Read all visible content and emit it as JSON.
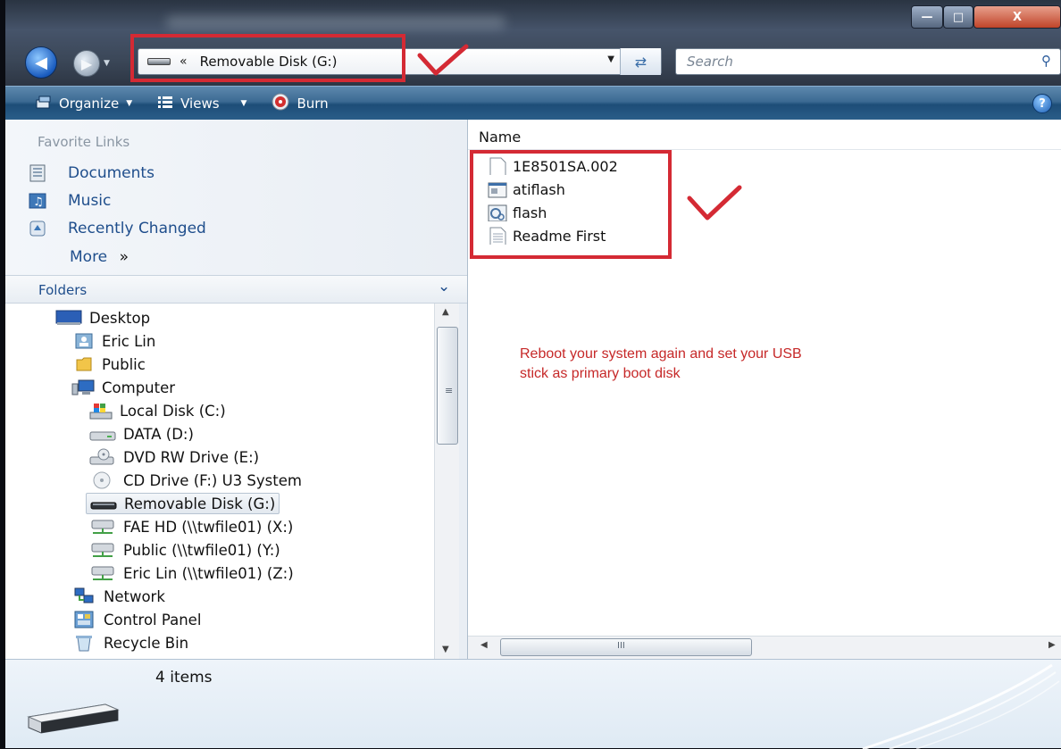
{
  "window": {
    "controls": {
      "minimize": "—",
      "maximize": "□",
      "close": "X"
    }
  },
  "address_bar": {
    "chevron": "«",
    "path": "Removable Disk (G:)"
  },
  "search": {
    "placeholder": "Search"
  },
  "toolbar": {
    "organize": "Organize",
    "views": "Views",
    "burn": "Burn",
    "help": "?"
  },
  "favorites": {
    "header": "Favorite Links",
    "items": [
      "Documents",
      "Music",
      "Recently Changed"
    ],
    "more": "More",
    "more_arrows": "»"
  },
  "folders": {
    "header": "Folders",
    "tree": [
      {
        "label": "Desktop",
        "icon": "desktop-icon"
      },
      {
        "label": "Eric Lin",
        "icon": "user-folder-icon"
      },
      {
        "label": "Public",
        "icon": "folder-icon"
      },
      {
        "label": "Computer",
        "icon": "computer-icon"
      },
      {
        "label": "Local Disk (C:)",
        "icon": "windows-drive-icon"
      },
      {
        "label": "DATA (D:)",
        "icon": "hard-drive-icon"
      },
      {
        "label": "DVD RW Drive (E:)",
        "icon": "dvd-drive-icon"
      },
      {
        "label": "CD Drive (F:) U3 System",
        "icon": "cd-icon"
      },
      {
        "label": "Removable Disk (G:)",
        "icon": "removable-disk-icon"
      },
      {
        "label": "FAE HD (\\\\twfile01) (X:)",
        "icon": "network-drive-icon"
      },
      {
        "label": "Public (\\\\twfile01) (Y:)",
        "icon": "network-drive-icon"
      },
      {
        "label": "Eric Lin (\\\\twfile01) (Z:)",
        "icon": "network-drive-icon"
      },
      {
        "label": "Network",
        "icon": "network-icon"
      },
      {
        "label": "Control Panel",
        "icon": "control-panel-icon"
      },
      {
        "label": "Recycle Bin",
        "icon": "recycle-bin-icon"
      }
    ]
  },
  "file_list": {
    "column_name": "Name",
    "files": [
      "1E8501SA.002",
      "atiflash",
      "flash",
      "Readme First"
    ]
  },
  "annotation": {
    "line1": "Reboot your system again and set your USB",
    "line2": "stick as primary boot disk",
    "color": "#c62828"
  },
  "details_pane": {
    "item_count": "4 items"
  },
  "colors": {
    "highlight_box": "#d42a34",
    "link": "#1f4e8c"
  }
}
